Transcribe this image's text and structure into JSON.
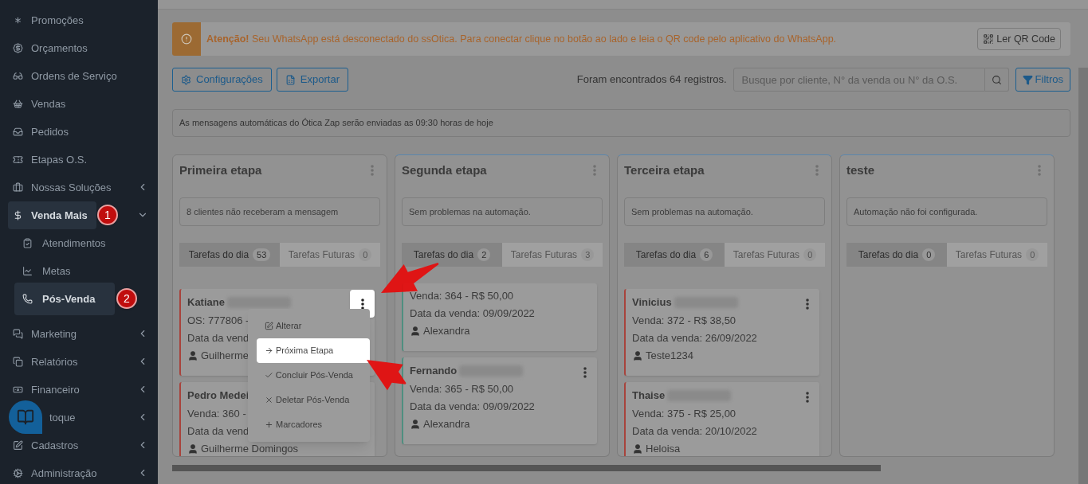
{
  "sidebar": {
    "items": [
      {
        "label": "Promoções",
        "kind": "link",
        "selected": false
      },
      {
        "label": "Orçamentos",
        "kind": "link",
        "selected": false
      },
      {
        "label": "Ordens de Serviço",
        "kind": "link",
        "selected": false
      },
      {
        "label": "Vendas",
        "kind": "link",
        "selected": false
      },
      {
        "label": "Pedidos",
        "kind": "link",
        "selected": false
      },
      {
        "label": "Etapas O.S.",
        "kind": "link",
        "selected": false
      },
      {
        "label": "Nossas Soluções",
        "kind": "group",
        "expanded": false,
        "selected": false
      },
      {
        "label": "Venda Mais",
        "kind": "group",
        "expanded": true,
        "selected": true,
        "badge": "1",
        "children": [
          {
            "label": "Atendimentos",
            "selected": false
          },
          {
            "label": "Metas",
            "selected": false
          },
          {
            "label": "Pós-Venda",
            "selected": true,
            "badge": "2"
          }
        ]
      },
      {
        "label": "Marketing",
        "kind": "group",
        "expanded": false,
        "selected": false
      },
      {
        "label": "Relatórios",
        "kind": "group",
        "expanded": false,
        "selected": false
      },
      {
        "label": "Financeiro",
        "kind": "group",
        "expanded": false,
        "selected": false
      },
      {
        "label": "toque",
        "kind": "group",
        "expanded": false,
        "selected": false
      },
      {
        "label": "Cadastros",
        "kind": "group",
        "expanded": false,
        "selected": false
      },
      {
        "label": "Administração",
        "kind": "group",
        "expanded": false,
        "selected": false
      }
    ]
  },
  "alert": {
    "title": "Atenção!",
    "message": "Seu WhatsApp está desconectado do ssOtica. Para conectar clique no botão ao lado e leia o QR code pelo aplicativo do WhatsApp.",
    "button": "Ler QR Code"
  },
  "toolbar": {
    "buttons": [
      "Configurações",
      "Exportar"
    ],
    "count_text": "Foram encontrados 64 registros.",
    "search": {
      "placeholder": "Busque por cliente, N° da venda ou N° da O.S."
    },
    "filter_button": "Filtros"
  },
  "info_message": "As mensagens automáticas do Ótica Zap serão enviadas as 09:30 horas de hoje",
  "columns": [
    {
      "title": "Primeira etapa",
      "status": "8 clientes não receberam a mensagem",
      "tabs": [
        {
          "label": "Tarefas do dia",
          "count": "53",
          "selected": true
        },
        {
          "label": "Tarefas Futuras",
          "count": "0",
          "selected": false
        }
      ],
      "cards": [
        {
          "name": "Katiane",
          "redacted": true,
          "lines": [
            "OS: 777806 -",
            "Data da vend"
          ],
          "person": "Guilherme",
          "color": "#a8433c",
          "menu_open": true
        },
        {
          "name": "Pedro Medei",
          "redacted": false,
          "lines": [
            "Venda: 360 -",
            "Data da vend"
          ],
          "person": "Guilherme Domingos",
          "color": "#a8433c"
        }
      ]
    },
    {
      "title": "Segunda etapa",
      "status": "Sem problemas na automação.",
      "tabs": [
        {
          "label": "Tarefas do dia",
          "count": "2",
          "selected": true
        },
        {
          "label": "Tarefas Futuras",
          "count": "3",
          "selected": false
        }
      ],
      "cards": [
        {
          "lines": [
            "Venda: 364 - R$ 50,00",
            "Data da venda: 09/09/2022"
          ],
          "person": "Alexandra",
          "color": "#4f8f80"
        },
        {
          "name": "Fernando",
          "redacted": true,
          "lines": [
            "Venda: 365 - R$ 50,00",
            "Data da venda: 09/09/2022"
          ],
          "person": "Alexandra",
          "color": "#4f8f80",
          "menu_open": false
        }
      ]
    },
    {
      "title": "Terceira etapa",
      "status": "Sem problemas na automação.",
      "tabs": [
        {
          "label": "Tarefas do dia",
          "count": "6",
          "selected": true
        },
        {
          "label": "Tarefas Futuras",
          "count": "0",
          "selected": false
        }
      ],
      "cards": [
        {
          "name": "Vinicius",
          "redacted": true,
          "lines": [
            "Venda: 372 - R$ 38,50",
            "Data da venda: 26/09/2022"
          ],
          "person": "Teste1234",
          "color": "#a8433c",
          "menu_open": false
        },
        {
          "name": "Thaise",
          "redacted": true,
          "lines": [
            "Venda: 375 - R$ 25,00",
            "Data da venda: 20/10/2022"
          ],
          "person": "Heloisa",
          "color": "#a8433c",
          "menu_open": false
        }
      ]
    },
    {
      "title": "teste",
      "status": "Automação não foi configurada.",
      "tabs": [
        {
          "label": "Tarefas do dia",
          "count": "0",
          "selected": true
        },
        {
          "label": "Tarefas Futuras",
          "count": "0",
          "selected": false
        }
      ]
    }
  ],
  "context_menu": {
    "items": [
      {
        "label": "Alterar",
        "selected": false
      },
      {
        "label": "Próxima Etapa",
        "selected": true
      },
      {
        "label": "Concluir Pós-Venda",
        "selected": false
      },
      {
        "label": "Deletar Pós-Venda",
        "selected": false
      },
      {
        "label": "Marcadores",
        "selected": false
      }
    ]
  }
}
